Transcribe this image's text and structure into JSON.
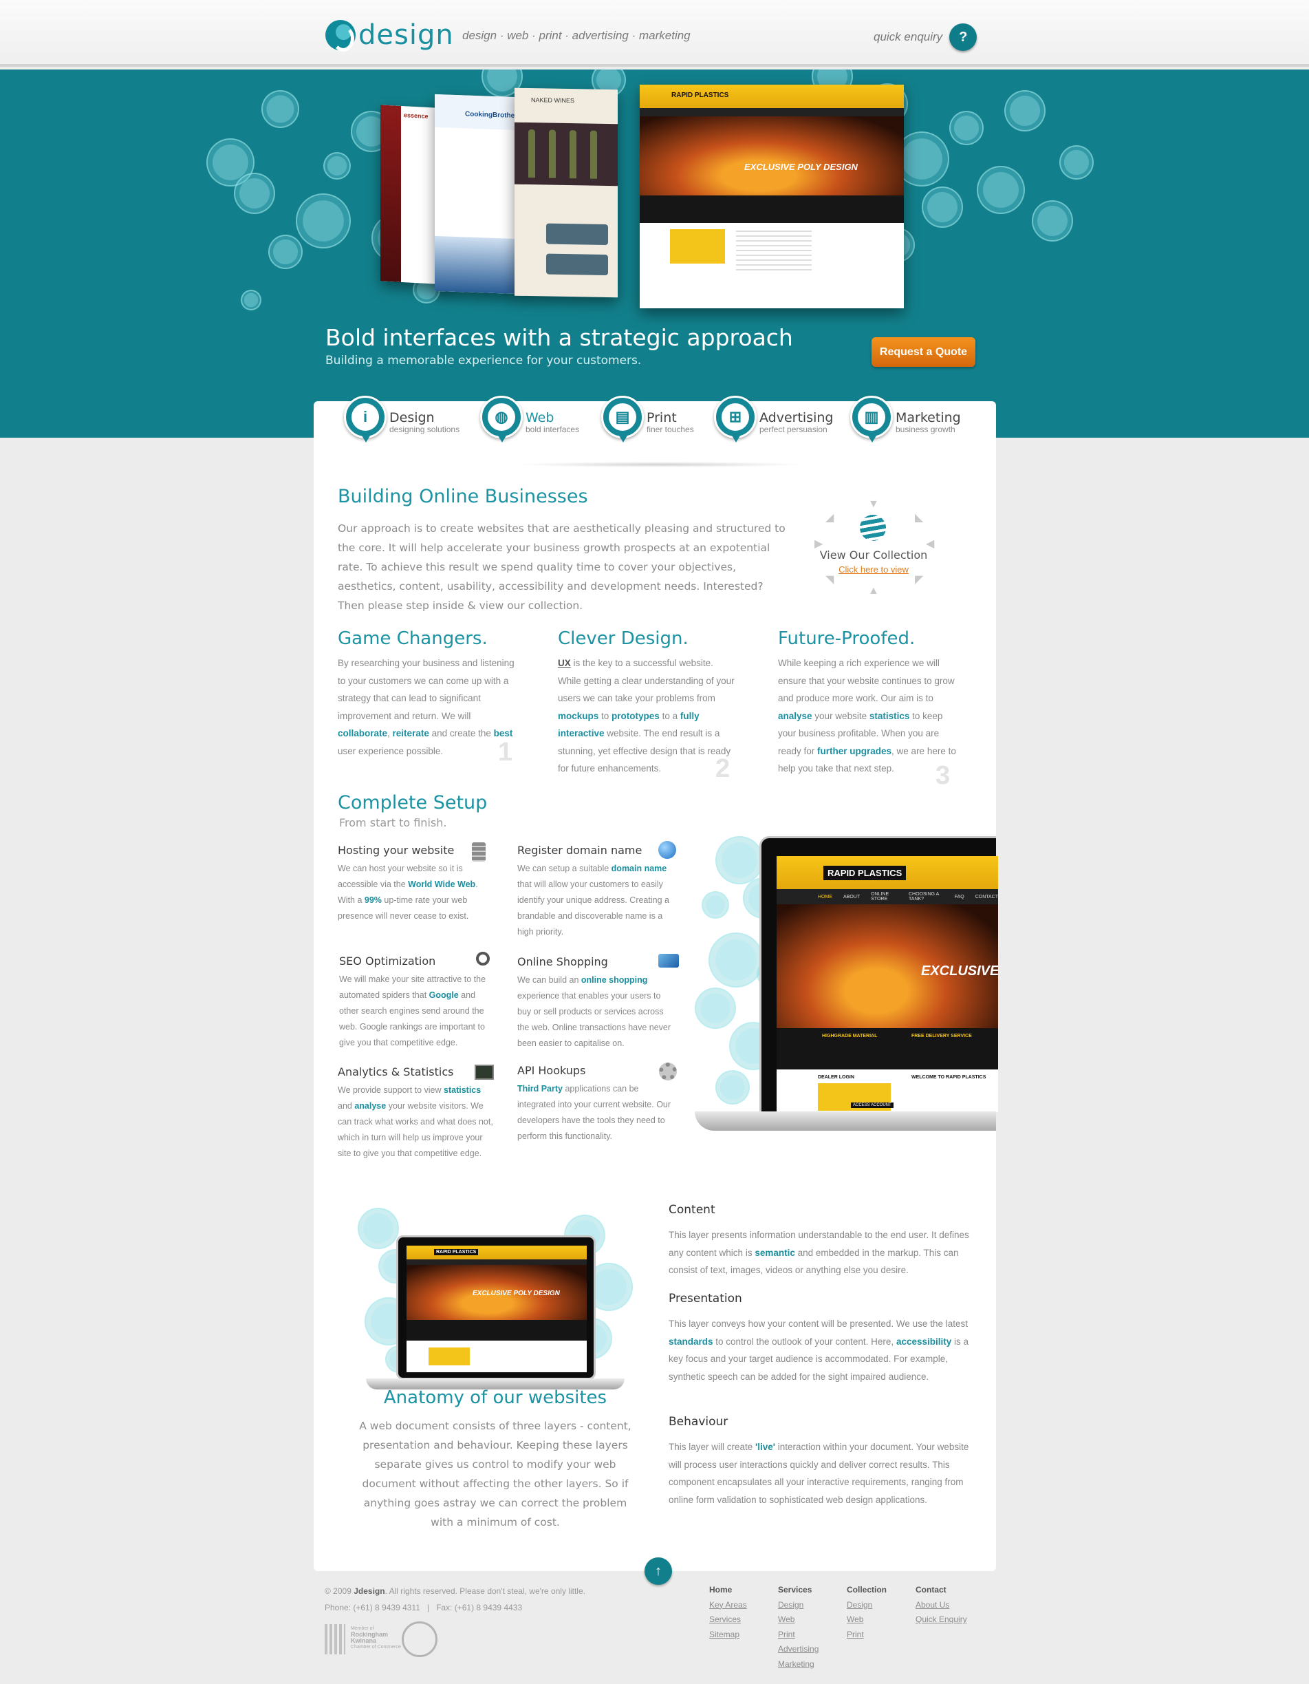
{
  "header": {
    "logo_text": "design",
    "tagline": "design · web · print · advertising · marketing",
    "enquiry_label": "quick enquiry",
    "enquiry_icon": "?"
  },
  "hero": {
    "title": "Bold interfaces with a strategic approach",
    "subtitle": "Building a memorable experience for your customers.",
    "cta": "Request a Quote",
    "shot_labels": [
      "essence",
      "CookingBrothers",
      "NAKED WINES",
      "RAPID PLASTICS",
      "EXCLUSIVE POLY DESIGN"
    ]
  },
  "services": [
    {
      "title": "Design",
      "sub": "designing solutions",
      "icon": "info-icon",
      "glyph": "i"
    },
    {
      "title": "Web",
      "sub": "bold interfaces",
      "icon": "globe-icon",
      "glyph": "◍"
    },
    {
      "title": "Print",
      "sub": "finer touches",
      "icon": "printer-icon",
      "glyph": "▤"
    },
    {
      "title": "Advertising",
      "sub": "perfect persuasion",
      "icon": "network-icon",
      "glyph": "⊞"
    },
    {
      "title": "Marketing",
      "sub": "business growth",
      "icon": "bar-chart-icon",
      "glyph": "▥"
    }
  ],
  "intro": {
    "title": "Building Online Businesses",
    "body": "Our approach is to create websites that are aesthetically pleasing and structured to the core. It will help accelerate your business growth prospects at an expotential rate. To achieve this result we spend quality time to cover your objectives, aesthetics, content, usability, accessibility and development needs. Interested? Then please step inside & view our collection."
  },
  "collection": {
    "title": "View Our Collection",
    "link": "Click here to view"
  },
  "pillars": [
    {
      "title": "Game Changers.",
      "num": "1",
      "parts": [
        "By researching your business and listening to your customers we can come up with a strategy that can lead to significant improvement and return. We will ",
        "collaborate",
        ", ",
        "reiterate",
        " and create the ",
        "best",
        " user experience possible."
      ]
    },
    {
      "title": "Clever Design.",
      "num": "2",
      "parts": [
        "UX",
        " is the key to a successful website. While getting a clear understanding of your users we can take your problems from ",
        "mockups",
        " to ",
        "prototypes",
        " to a ",
        "fully interactive",
        " website. The end result is a stunning, yet effective design that is ready for future enhancements."
      ]
    },
    {
      "title": "Future-Proofed.",
      "num": "3",
      "parts": [
        "While keeping a rich experience we will ensure that your website continues to grow and produce more work. Our aim is to ",
        "analyse",
        " your website ",
        "statistics",
        " to keep your business profitable. When you are ready for ",
        "further upgrades",
        ", we are here to help you take that next step."
      ]
    }
  ],
  "setup": {
    "title": "Complete Setup",
    "subtitle": "From start to finish.",
    "features": [
      {
        "title": "Hosting your website",
        "icon": "server-icon",
        "parts": [
          "We can host your website so it is accessible via the ",
          "World Wide Web",
          ". With a ",
          "99%",
          " up-time rate your web presence will never cease to exist."
        ]
      },
      {
        "title": "Register domain name",
        "icon": "globe-icon",
        "parts": [
          "We can setup a suitable ",
          "domain name",
          " that will allow your customers to easily identify your unique address. Creating a brandable and discoverable name is a high priority."
        ]
      },
      {
        "title": "SEO Optimization",
        "icon": "magnifier-icon",
        "parts": [
          "We will make your site attractive to the automated spiders that ",
          "Google",
          " and other search engines send around the web. Google rankings are important to give you that competitive edge."
        ]
      },
      {
        "title": "Online Shopping",
        "icon": "credit-card-icon",
        "parts": [
          "We can build an ",
          "online shopping",
          " experience that enables your users to buy or sell products or services across the web. Online transactions have never been easier to capitalise on."
        ]
      },
      {
        "title": "Analytics & Statistics",
        "icon": "monitor-chart-icon",
        "parts": [
          "We provide support to view ",
          "statistics",
          " and ",
          "analyse",
          " your website visitors. We can track what works and what does not, which in turn will help us improve your site to give you that competitive edge."
        ]
      },
      {
        "title": "API Hookups",
        "icon": "cog-icon",
        "parts": [
          "",
          "Third Party",
          " applications can be integrated into your current website. Our developers have the tools they need to perform this functionality."
        ]
      }
    ]
  },
  "laptop_site": {
    "brand": "RAPID PLASTICS",
    "headline": "EXCLUSIVE",
    "nav": [
      "HOME",
      "ABOUT",
      "ONLINE STORE",
      "CHOOSING A TANK?",
      "FAQ",
      "CONTACT"
    ],
    "cols": [
      "HIGHGRADE MATERIAL",
      "FREE DELIVERY SERVICE"
    ],
    "login": "DEALER LOGIN",
    "welcome": "WELCOME TO RAPID PLASTICS",
    "access": "ACCESS ACCOUNT"
  },
  "anatomy": {
    "title": "Anatomy of our websites",
    "body": "A web document consists of three layers - content, presentation and behaviour. Keeping these layers separate gives us control to modify your web document without affecting the other layers. So if anything goes astray we can correct the problem with a minimum of cost.",
    "small_headline": "EXCLUSIVE POLY DESIGN"
  },
  "layers": [
    {
      "title": "Content",
      "parts": [
        "This layer presents information understandable to the end user. It defines any content which is ",
        "semantic",
        " and embedded in the markup. This can consist of text, images, videos or anything else you desire."
      ]
    },
    {
      "title": "Presentation",
      "parts": [
        "This layer conveys how your content will be presented. We use the latest ",
        "standards",
        " to control the outlook of your content. Here, ",
        "accessibility",
        " is a key focus and your target audience is accommodated. For example, synthetic speech can be added for the sight impaired audience."
      ]
    },
    {
      "title": "Behaviour",
      "parts": [
        "This layer will create ",
        "'live'",
        " interaction within your document. Your website will process user interactions quickly and deliver correct results. This component encapsulates all your interactive requirements, ranging from online form validation to sophisticated web design applications."
      ]
    }
  ],
  "footer": {
    "copyright_pre": "© 2009 ",
    "copyright_brand": "Jdesign",
    "copyright_post": ". All rights reserved. Please don't steal, we're only little.",
    "phone": "Phone: (+61) 8 9439 4311",
    "separator": "|",
    "fax": "Fax: (+61) 8 9439 4433",
    "badge_text": [
      "Member of",
      "Rockingham",
      "Kwinana",
      "Chamber of Commerce"
    ],
    "columns": [
      {
        "heading": "Home",
        "links": [
          "Key Areas",
          "Services",
          "Sitemap"
        ]
      },
      {
        "heading": "Services",
        "links": [
          "Design",
          "Web",
          "Print",
          "Advertising",
          "Marketing"
        ]
      },
      {
        "heading": "Collection",
        "links": [
          "Design",
          "Web",
          "Print"
        ]
      },
      {
        "heading": "Contact",
        "links": [
          "About Us",
          "Quick Enquiry"
        ]
      }
    ],
    "top_icon": "↑"
  },
  "colors": {
    "teal": "#12808c",
    "accent": "#1a8fa0",
    "orange": "#e07c1a",
    "background": "#ececec"
  }
}
